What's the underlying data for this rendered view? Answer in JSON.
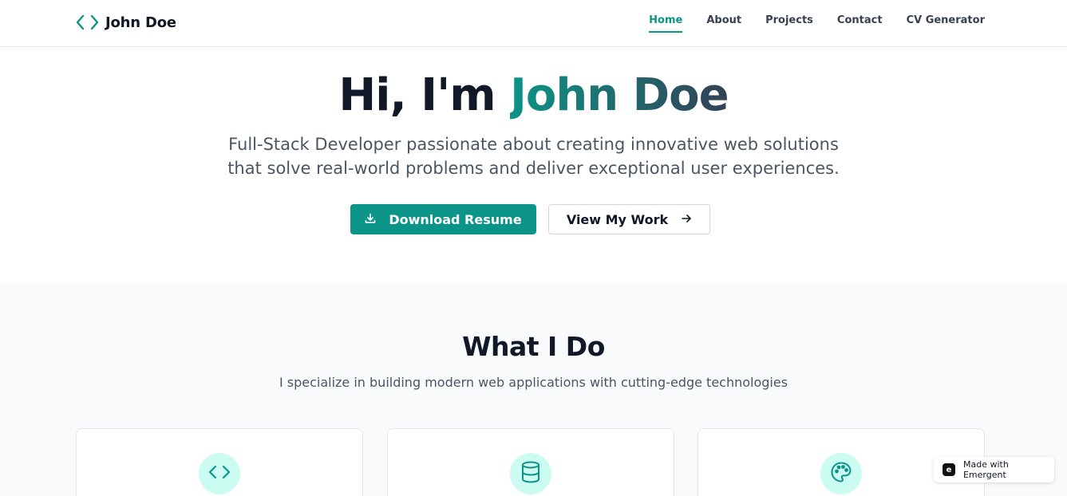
{
  "brand": {
    "name": "John Doe",
    "icon": "code-icon"
  },
  "nav": {
    "items": [
      {
        "label": "Home",
        "active": true
      },
      {
        "label": "About",
        "active": false
      },
      {
        "label": "Projects",
        "active": false
      },
      {
        "label": "Contact",
        "active": false
      },
      {
        "label": "CV Generator",
        "active": false
      }
    ]
  },
  "hero": {
    "greeting": "Hi, I'm ",
    "name": "John Doe",
    "subtitle_line1": "Full-Stack Developer passionate about creating innovative web solutions",
    "subtitle_line2": "that solve real-world problems and deliver exceptional user experiences.",
    "primary_button": {
      "label": "Download Resume",
      "icon": "download-icon"
    },
    "secondary_button": {
      "label": "View My Work",
      "icon": "arrow-right-icon"
    }
  },
  "services": {
    "title": "What I Do",
    "subtitle": "I specialize in building modern web applications with cutting-edge technologies",
    "cards": [
      {
        "icon": "code-icon"
      },
      {
        "icon": "database-icon"
      },
      {
        "icon": "palette-icon"
      }
    ]
  },
  "badge": {
    "label": "Made with Emergent",
    "logo_letter": "e"
  },
  "colors": {
    "accent": "#0d9488",
    "accent_light": "#ccfbf1",
    "text_dark": "#111827",
    "text_muted": "#4b5563",
    "section_bg": "#f8fafc"
  }
}
